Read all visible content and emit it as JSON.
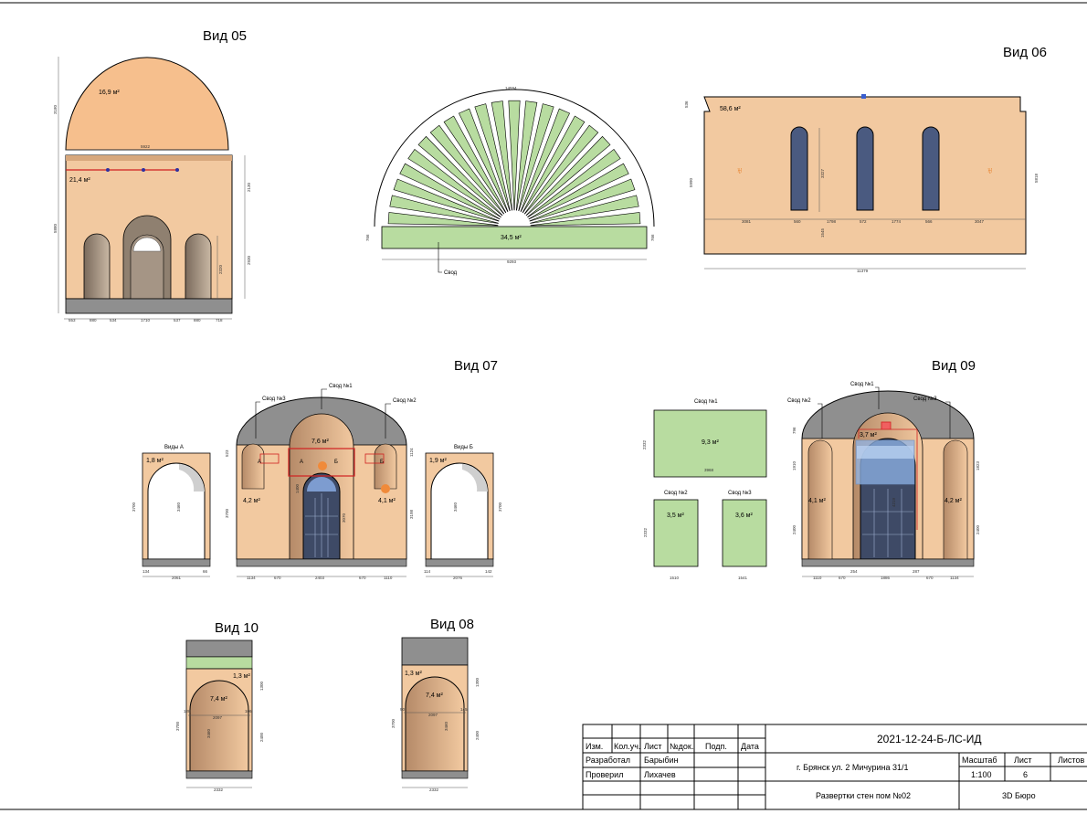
{
  "views": {
    "v05": {
      "title": "Вид 05",
      "area_dome": "16,9 м²",
      "area_wall": "21,4 м²",
      "dims": {
        "width": "5922",
        "h_total": "5880",
        "h_top": "3180",
        "h_mid": "2130",
        "h_low": "2930",
        "h_arch": "2320"
      },
      "bottom_dims": [
        "553",
        "880",
        "534",
        "1710",
        "537",
        "880",
        "718"
      ]
    },
    "v06": {
      "title": "Вид 06",
      "area": "58,6 м²",
      "dims": {
        "width": "11379",
        "h_left": "5990",
        "h_right": "5818",
        "top": "536",
        "win_h": "3327",
        "win_base": "1545"
      },
      "bottom_dims": [
        "3081",
        "560",
        "1798",
        "572",
        "1774",
        "566",
        "3047"
      ]
    },
    "fan": {
      "area": "34,5 м²",
      "label": "Свод",
      "dims": {
        "arc": "14594",
        "width": "9293",
        "h_left": "766",
        "h_right": "766"
      }
    },
    "v07": {
      "title": "Вид 07",
      "vault1": "Свод №1",
      "vault2": "Свод №2",
      "vault3": "Свод №3",
      "area_center": "7,6 м²",
      "area_left": "4,2 м²",
      "area_right": "4,1 м²",
      "mark_a": "А",
      "mark_b": "Б",
      "dims": {
        "h_left": "3700",
        "h_right": "3198",
        "h_mid": "3070",
        "top_l": "523",
        "top_r": "1124",
        "inner": "1400"
      },
      "bottom_dims": [
        "1134",
        "670",
        "2403",
        "670",
        "1110"
      ]
    },
    "viewA": {
      "title": "Виды А",
      "area": "1,8 м²",
      "dims": {
        "h": "3700",
        "inner": "3460"
      },
      "bottom_dims": [
        "134",
        "2061",
        "66"
      ]
    },
    "viewB": {
      "title": "Виды Б",
      "area": "1,9 м²",
      "dims": {
        "h": "3700",
        "inner": "3460"
      },
      "bottom_dims": [
        "114",
        "2076",
        "142"
      ]
    },
    "vault_panels": {
      "p1": {
        "title": "Свод №1",
        "area": "9,3 м²",
        "dims": {
          "w": "3968",
          "h": "2332"
        }
      },
      "p2": {
        "title": "Свод №2",
        "area": "3,5 м²",
        "dims": {
          "w": "1510",
          "h": "2332"
        }
      },
      "p3": {
        "title": "Свод №3",
        "area": "3,6 м²",
        "dims": {
          "w": "1541"
        }
      }
    },
    "v09": {
      "title": "Вид 09",
      "vault1": "Свод №1",
      "vault2": "Свод №2",
      "vault3": "Свод №3",
      "area_center": "3,7 м²",
      "area_left": "4,1 м²",
      "area_right": "4,2 м²",
      "dims": {
        "h_left": "2400",
        "h_right": "2400",
        "top": "796",
        "mid": "1910",
        "top_r": "1823",
        "door": "4219"
      },
      "bottom_dims": [
        "1110",
        "670",
        "1886",
        "670",
        "1134"
      ],
      "sub_dims": [
        "254",
        "287"
      ]
    },
    "v10": {
      "title": "Вид 10",
      "area_main": "7,4 м²",
      "area_top": "1,3 м²",
      "dims": {
        "w": "2332",
        "inner": "2097",
        "h": "3700",
        "h_upper": "1300",
        "h_lower": "2400",
        "arch": "3460",
        "side_l": "128",
        "side_r": "106"
      }
    },
    "v08": {
      "title": "Вид 08",
      "area_main": "7,4 м²",
      "area_top": "1,3 м²",
      "dims": {
        "w": "2332",
        "inner": "2097",
        "h": "3700",
        "h_upper": "1300",
        "h_lower": "2400",
        "arch": "3460",
        "side_l": "90",
        "side_r": "145"
      }
    }
  },
  "title_block": {
    "headers": [
      "Изм.",
      "Кол.уч.",
      "Лист",
      "№док.",
      "Подп.",
      "Дата"
    ],
    "developed_label": "Разработал",
    "developed_name": "Барыбин",
    "checked_label": "Проверил",
    "checked_name": "Лихачев",
    "doc_code": "2021-12-24-Б-ЛС-ИД",
    "address": "г. Брянск ул. 2 Мичурина 31/1",
    "scale_label": "Масштаб",
    "scale_value": "1:100",
    "sheet_label": "Лист",
    "sheet_value": "6",
    "sheets_label": "Листов",
    "description": "Развертки стен пом №02",
    "company": "3D Бюро"
  },
  "colors": {
    "wall": "#f2c9a0",
    "dome": "#f6bf8d",
    "green": "#b8dca0",
    "grey": "#8f8f8f",
    "dark_grey": "#6f6f6f",
    "glass": "#6f8fbf",
    "red": "#d02020",
    "blue_overlay": "#8fb4e8"
  }
}
